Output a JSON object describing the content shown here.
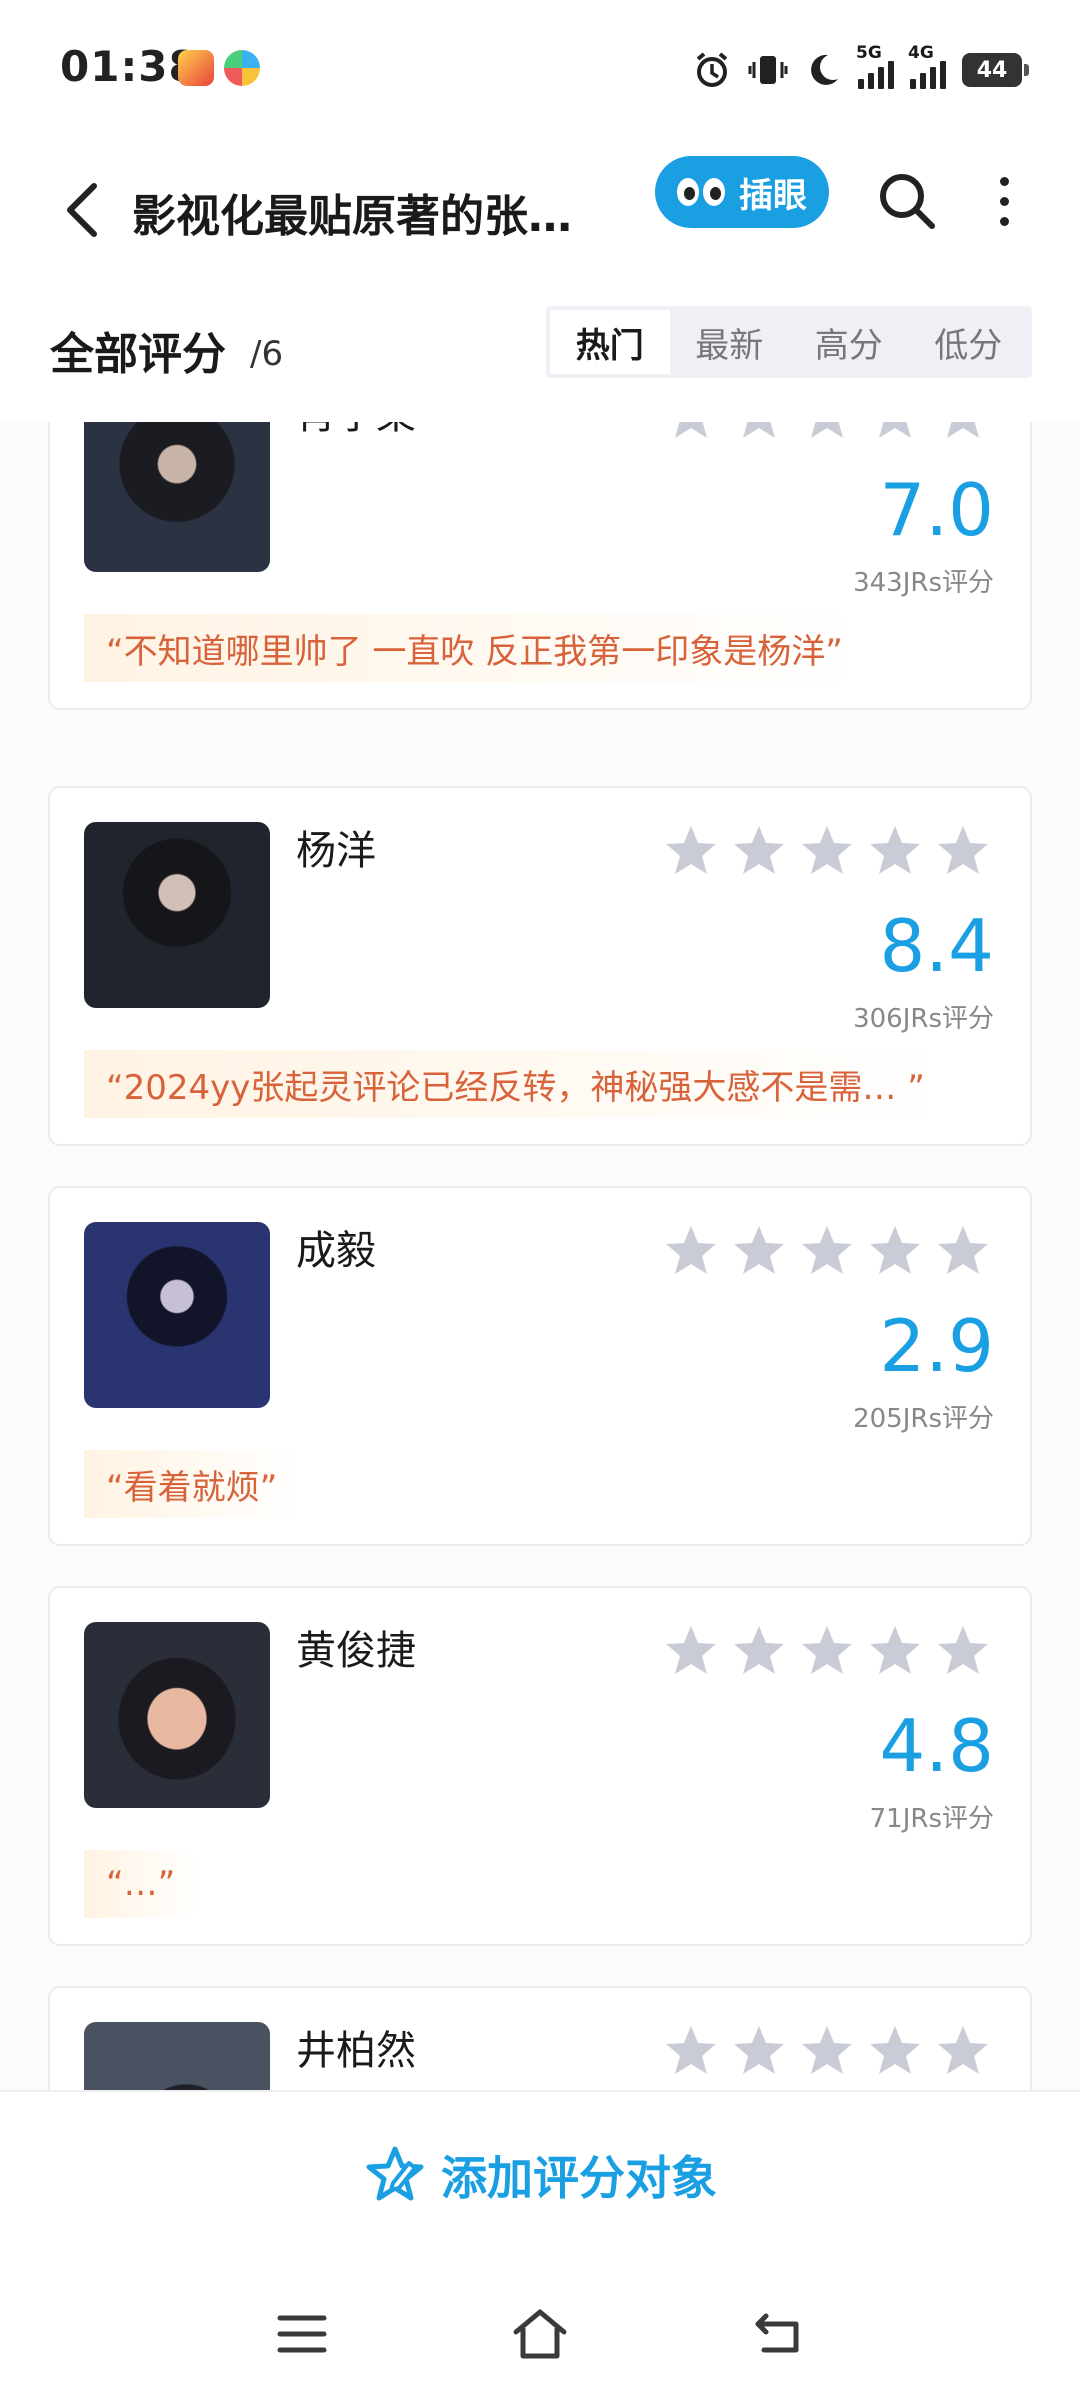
{
  "status": {
    "time": "01:38",
    "sig1": "5G",
    "sig2": "4G",
    "battery": "44"
  },
  "header": {
    "title": "影视化最贴原著的张…",
    "pill_label": "插眼"
  },
  "filter": {
    "title": "全部评分",
    "count": "/6",
    "tabs": [
      "热门",
      "最新",
      "高分",
      "低分"
    ],
    "active_tab": "热门"
  },
  "ratings": [
    {
      "name": "肖宇梁",
      "score": "7.0",
      "count": "343JRs评分",
      "comment": "“不知道哪里帅了 一直吹 反正我第一印象是杨洋”"
    },
    {
      "name": "杨洋",
      "score": "8.4",
      "count": "306JRs评分",
      "comment": "“2024yy张起灵评论已经反转，神秘强大感不是需…  ”"
    },
    {
      "name": "成毅",
      "score": "2.9",
      "count": "205JRs评分",
      "comment": "“看着就烦”"
    },
    {
      "name": "黄俊捷",
      "score": "4.8",
      "count": "71JRs评分",
      "comment": "“…”"
    },
    {
      "name": "井柏然"
    }
  ],
  "bottom": {
    "add_label": "添加评分对象"
  },
  "colors": {
    "accent": "#1a9fe3",
    "comment": "#d8623a",
    "star_empty": "#c9ccd6"
  }
}
